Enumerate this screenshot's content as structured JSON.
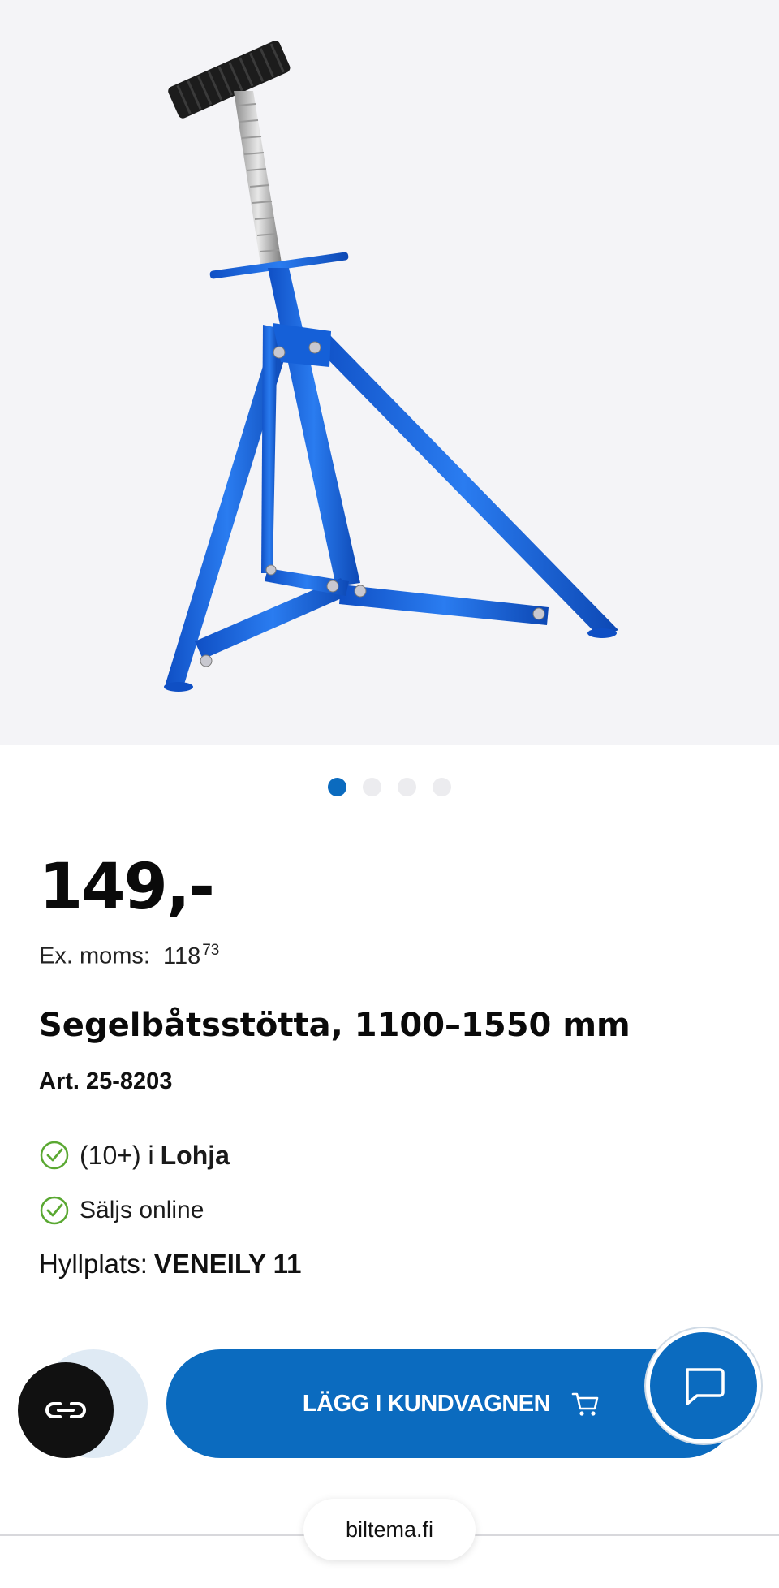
{
  "product": {
    "image_alt": "Segelbåtsstötta",
    "gallery_count": 4,
    "gallery_active": 1,
    "price": "149,-",
    "ex_moms_label": "Ex. moms:",
    "ex_moms_whole": "118",
    "ex_moms_cents": "73",
    "title": "Segelbåtsstötta, 1100–1550 mm",
    "article": "Art. 25-8203"
  },
  "availability": {
    "store_count": "(10+) i",
    "store_name": "Lohja",
    "online": "Säljs online",
    "shelf_label": "Hyllplats:",
    "shelf_value": "VENEILY 11"
  },
  "actions": {
    "add_to_cart": "LÄGG I KUNDVAGNEN"
  },
  "browser": {
    "domain": "biltema.fi"
  },
  "colors": {
    "brand_blue": "#0b6bbf",
    "check_green": "#5aa832",
    "stand_blue": "#1560d8"
  }
}
